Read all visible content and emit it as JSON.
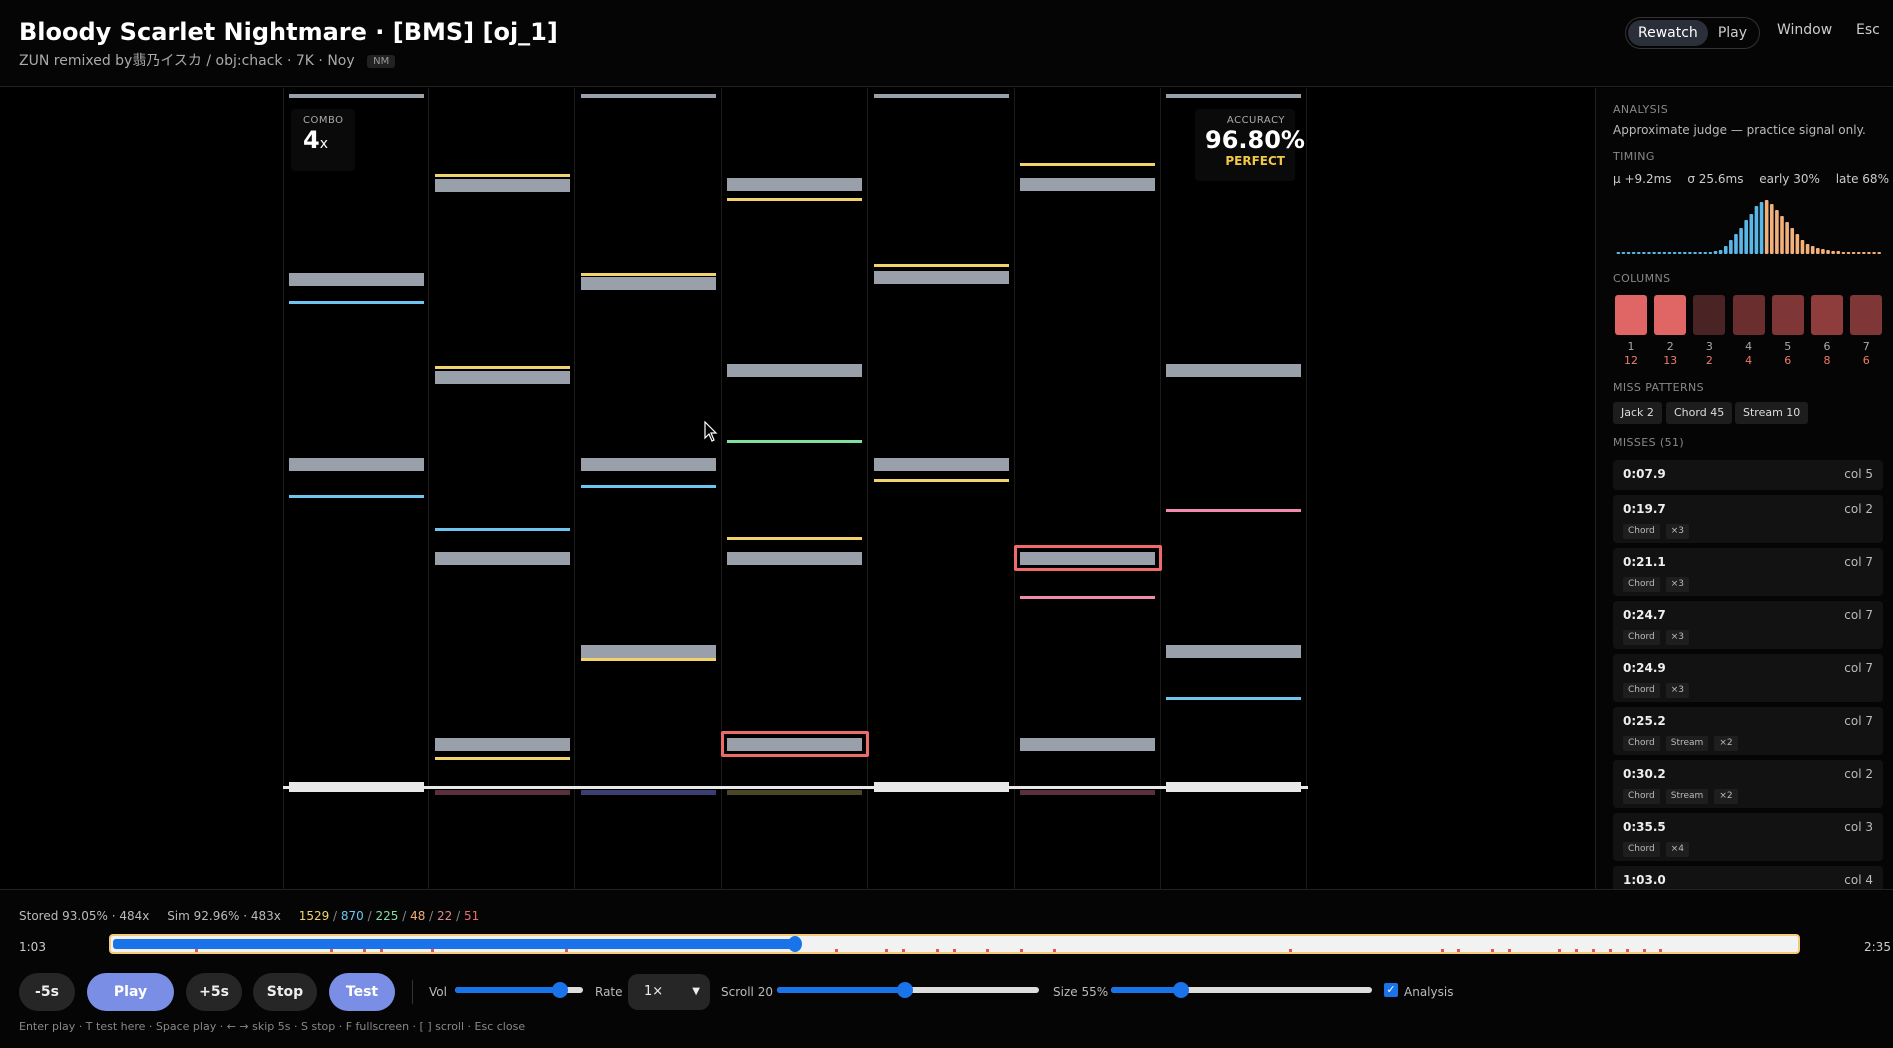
{
  "header": {
    "title": "Bloody Scarlet Nightmare · [BMS] [oj_1]",
    "subtitle": "ZUN remixed by翡乃イスカ / obj:chack · 7K · Noy",
    "mod_badge": "NM",
    "modes": [
      "Rewatch",
      "Play"
    ],
    "active_mode": "Rewatch",
    "window_label": "Window",
    "esc_label": "Esc"
  },
  "playfield": {
    "combo_label": "COMBO",
    "combo_value": "4",
    "combo_suffix": "x",
    "accuracy_label": "ACCURACY",
    "accuracy_value": "96.80%",
    "judgement": "PERFECT",
    "lane_count": 7,
    "colors": {
      "note": "#9aa0aa",
      "miss_outline": "#ef6b6b",
      "yellow": "#f2d36b",
      "blue": "#6ec6f0",
      "green": "#7fe0a0",
      "pink": "#f08ab0"
    }
  },
  "analysis": {
    "label": "ANALYSIS",
    "note": "Approximate judge — practice signal only.",
    "timing_label": "TIMING",
    "timing_stats": [
      "μ +9.2ms",
      "σ 25.6ms",
      "early 30%",
      "late 68%"
    ],
    "histogram_colors": {
      "early": "#5ab8e8",
      "late": "#f2b07a"
    },
    "columns_label": "COLUMNS",
    "columns": [
      {
        "num": "1",
        "misses": "12",
        "color": "#e06666"
      },
      {
        "num": "2",
        "misses": "13",
        "color": "#e06666"
      },
      {
        "num": "3",
        "misses": "2",
        "color": "#4a2424"
      },
      {
        "num": "4",
        "misses": "4",
        "color": "#6a2e2e"
      },
      {
        "num": "5",
        "misses": "6",
        "color": "#7e3636"
      },
      {
        "num": "6",
        "misses": "8",
        "color": "#8e3c3c"
      },
      {
        "num": "7",
        "misses": "6",
        "color": "#7e3636"
      }
    ],
    "patterns_label": "MISS PATTERNS",
    "patterns": [
      "Jack 2",
      "Chord 45",
      "Stream 10"
    ],
    "misses_label": "MISSES (51)",
    "misses": [
      {
        "time": "0:07.9",
        "col": "col 5",
        "tags": []
      },
      {
        "time": "0:19.7",
        "col": "col 2",
        "tags": [
          "Chord",
          "×3"
        ]
      },
      {
        "time": "0:21.1",
        "col": "col 7",
        "tags": [
          "Chord",
          "×3"
        ]
      },
      {
        "time": "0:24.7",
        "col": "col 7",
        "tags": [
          "Chord",
          "×3"
        ]
      },
      {
        "time": "0:24.9",
        "col": "col 7",
        "tags": [
          "Chord",
          "×3"
        ]
      },
      {
        "time": "0:25.2",
        "col": "col 7",
        "tags": [
          "Chord",
          "Stream",
          "×2"
        ]
      },
      {
        "time": "0:30.2",
        "col": "col 2",
        "tags": [
          "Chord",
          "Stream",
          "×2"
        ]
      },
      {
        "time": "0:35.5",
        "col": "col 3",
        "tags": [
          "Chord",
          "×4"
        ]
      },
      {
        "time": "1:03.0",
        "col": "col 4",
        "tags": []
      }
    ]
  },
  "footer": {
    "stored": "Stored 93.05% · 484x",
    "sim": "Sim 92.96% · 483x",
    "judge_counts": [
      {
        "v": "1529",
        "color": "#f2d36b"
      },
      {
        "v": "870",
        "color": "#6ec6f0"
      },
      {
        "v": "225",
        "color": "#7fe0a0"
      },
      {
        "v": "48",
        "color": "#f2b07a"
      },
      {
        "v": "22",
        "color": "#e08a8a"
      },
      {
        "v": "51",
        "color": "#ef6b6b"
      }
    ],
    "current_time": "1:03",
    "total_time": "2:35",
    "progress_fraction": 0.406,
    "buttons": {
      "back5": "-5s",
      "play": "Play",
      "fwd5": "+5s",
      "stop": "Stop",
      "test": "Test"
    },
    "vol_label": "Vol",
    "vol_fraction": 0.82,
    "rate_label": "Rate",
    "rate_value": "1×",
    "scroll_label": "Scroll 20",
    "scroll_fraction": 0.49,
    "size_label": "Size 55%",
    "size_fraction": 0.27,
    "analysis_toggle_label": "Analysis",
    "analysis_checked": true,
    "hint": "Enter play · T test here · Space play · ← → skip 5s · S stop · F fullscreen · [ ] scroll · Esc close"
  }
}
